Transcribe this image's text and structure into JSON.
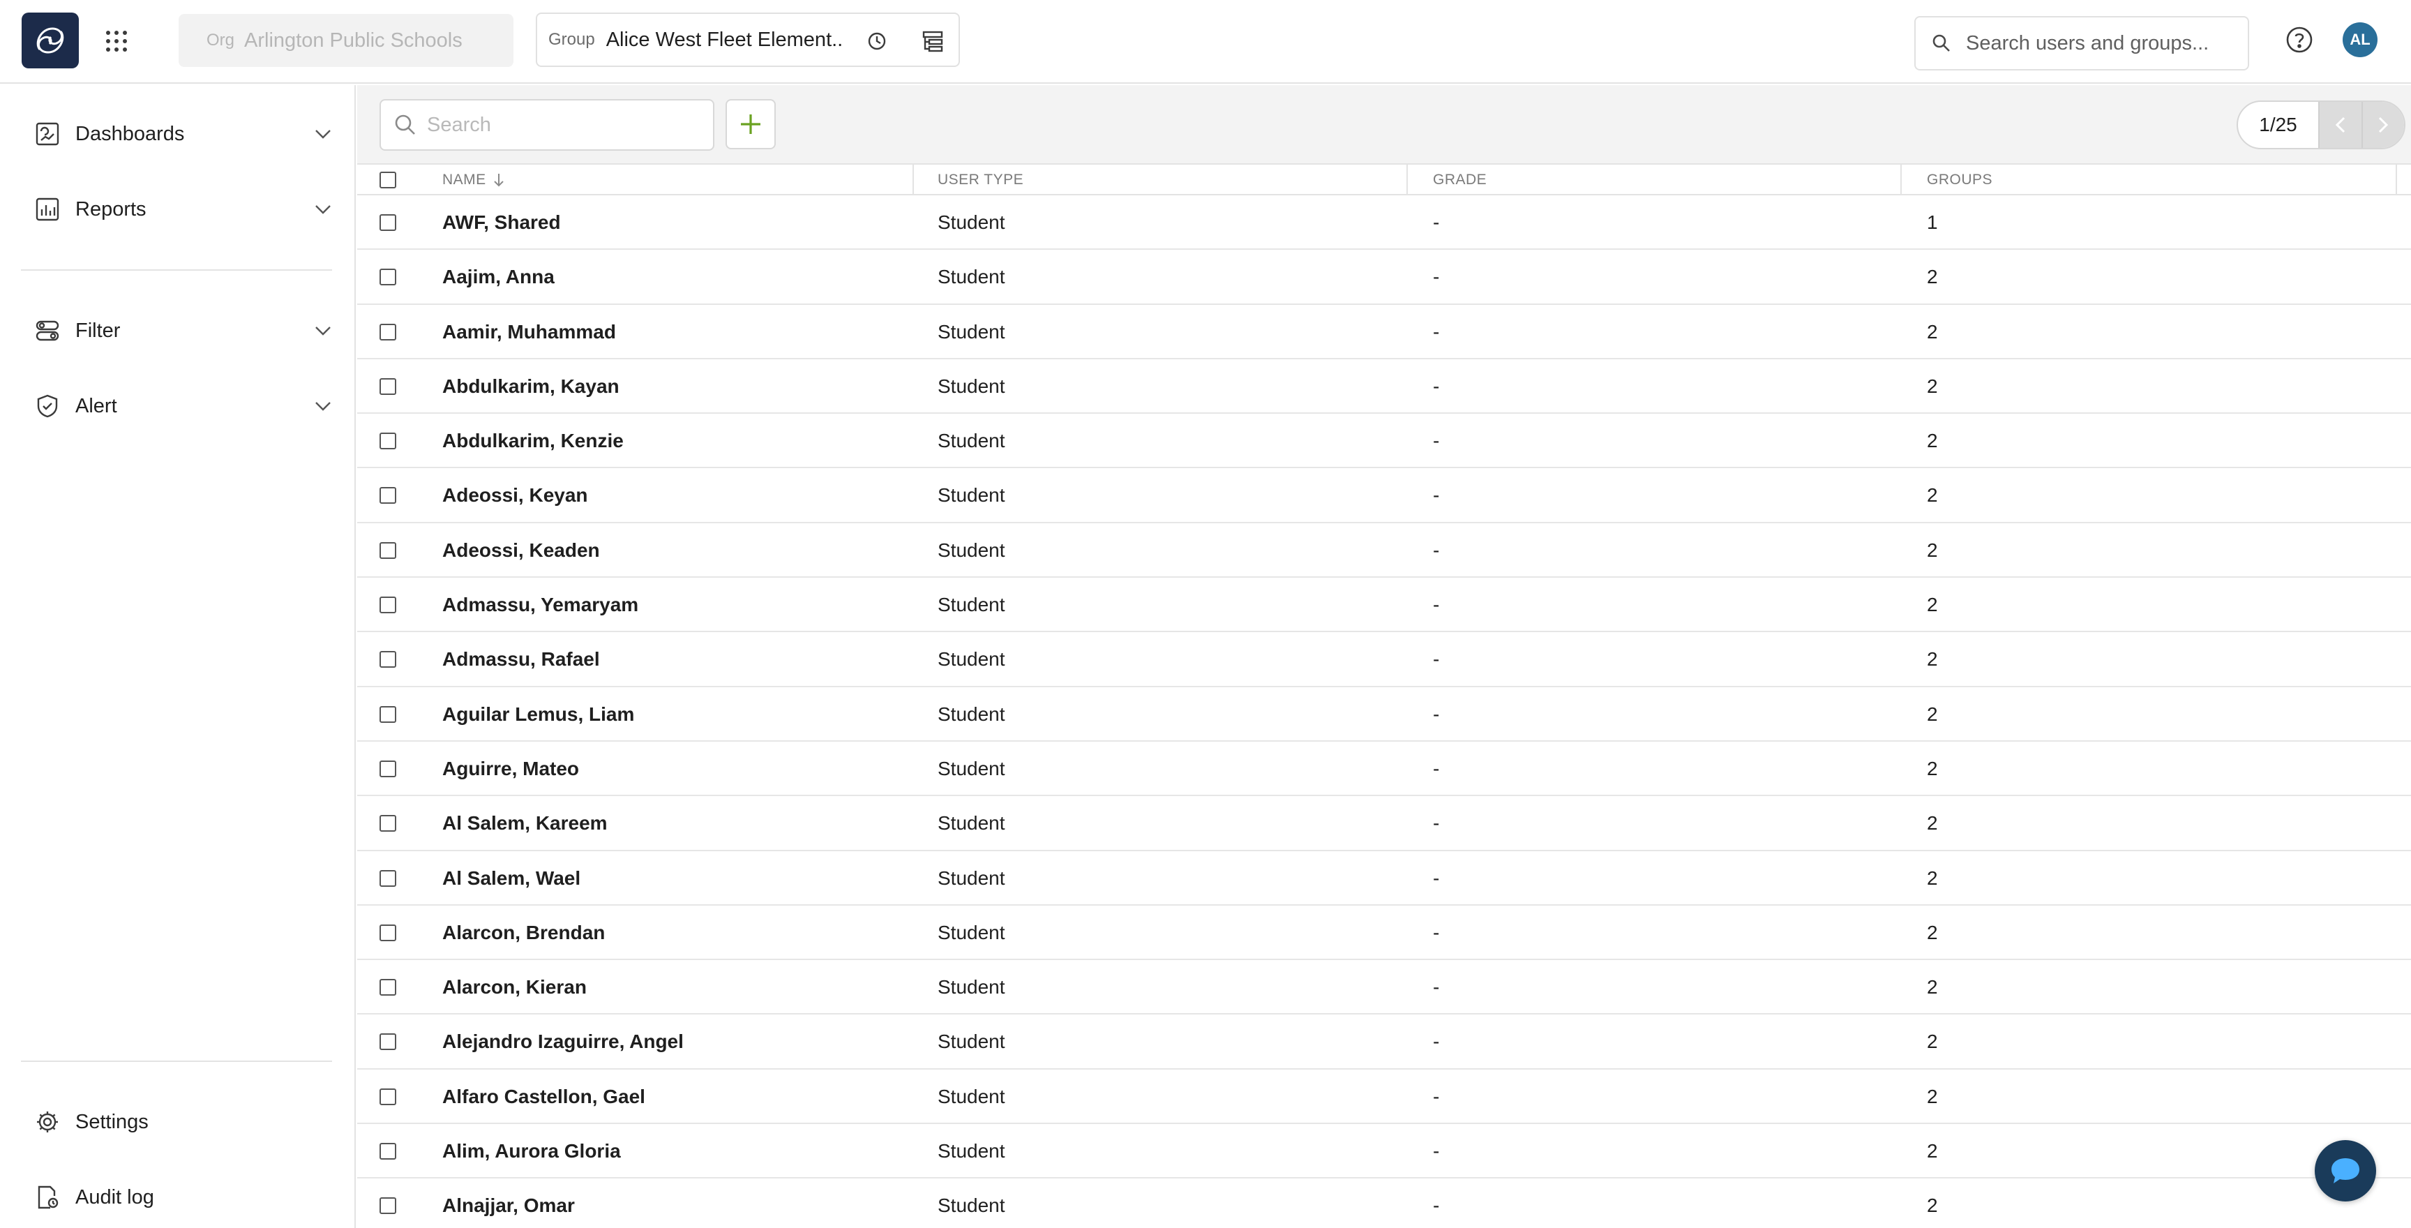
{
  "topbar": {
    "org_label": "Org",
    "org_value": "Arlington Public Schools",
    "group_label": "Group",
    "group_value": "Alice West Fleet Element...",
    "search_placeholder": "Search users and groups...",
    "avatar_initials": "AL"
  },
  "sidebar": {
    "items": [
      {
        "label": "Dashboards",
        "icon": "dashboard-icon"
      },
      {
        "label": "Reports",
        "icon": "reports-icon"
      },
      {
        "label": "Filter",
        "icon": "filter-icon"
      },
      {
        "label": "Alert",
        "icon": "alert-icon"
      }
    ],
    "bottom": [
      {
        "label": "Settings",
        "icon": "gear-icon"
      },
      {
        "label": "Audit log",
        "icon": "audit-log-icon"
      }
    ]
  },
  "toolbar": {
    "search_placeholder": "Search",
    "page_indicator": "1/25"
  },
  "table": {
    "columns": [
      "NAME",
      "USER TYPE",
      "GRADE",
      "GROUPS"
    ],
    "rows": [
      {
        "name": "AWF, Shared",
        "user_type": "Student",
        "grade": "-",
        "groups": "1"
      },
      {
        "name": "Aajim, Anna",
        "user_type": "Student",
        "grade": "-",
        "groups": "2"
      },
      {
        "name": "Aamir, Muhammad",
        "user_type": "Student",
        "grade": "-",
        "groups": "2"
      },
      {
        "name": "Abdulkarim, Kayan",
        "user_type": "Student",
        "grade": "-",
        "groups": "2"
      },
      {
        "name": "Abdulkarim, Kenzie",
        "user_type": "Student",
        "grade": "-",
        "groups": "2"
      },
      {
        "name": "Adeossi, Keyan",
        "user_type": "Student",
        "grade": "-",
        "groups": "2"
      },
      {
        "name": "Adeossi, Keaden",
        "user_type": "Student",
        "grade": "-",
        "groups": "2"
      },
      {
        "name": "Admassu, Yemaryam",
        "user_type": "Student",
        "grade": "-",
        "groups": "2"
      },
      {
        "name": "Admassu, Rafael",
        "user_type": "Student",
        "grade": "-",
        "groups": "2"
      },
      {
        "name": "Aguilar Lemus, Liam",
        "user_type": "Student",
        "grade": "-",
        "groups": "2"
      },
      {
        "name": "Aguirre, Mateo",
        "user_type": "Student",
        "grade": "-",
        "groups": "2"
      },
      {
        "name": "Al Salem, Kareem",
        "user_type": "Student",
        "grade": "-",
        "groups": "2"
      },
      {
        "name": "Al Salem, Wael",
        "user_type": "Student",
        "grade": "-",
        "groups": "2"
      },
      {
        "name": "Alarcon, Brendan",
        "user_type": "Student",
        "grade": "-",
        "groups": "2"
      },
      {
        "name": "Alarcon, Kieran",
        "user_type": "Student",
        "grade": "-",
        "groups": "2"
      },
      {
        "name": "Alejandro Izaguirre, Angel",
        "user_type": "Student",
        "grade": "-",
        "groups": "2"
      },
      {
        "name": "Alfaro Castellon, Gael",
        "user_type": "Student",
        "grade": "-",
        "groups": "2"
      },
      {
        "name": "Alim, Aurora Gloria",
        "user_type": "Student",
        "grade": "-",
        "groups": "2"
      },
      {
        "name": "Alnajjar, Omar",
        "user_type": "Student",
        "grade": "-",
        "groups": "2"
      }
    ]
  },
  "colors": {
    "brand": "#1c2b4a",
    "accent_green": "#6aa221",
    "avatar": "#2a6f9a",
    "chat_button": "#1a3b5a"
  }
}
